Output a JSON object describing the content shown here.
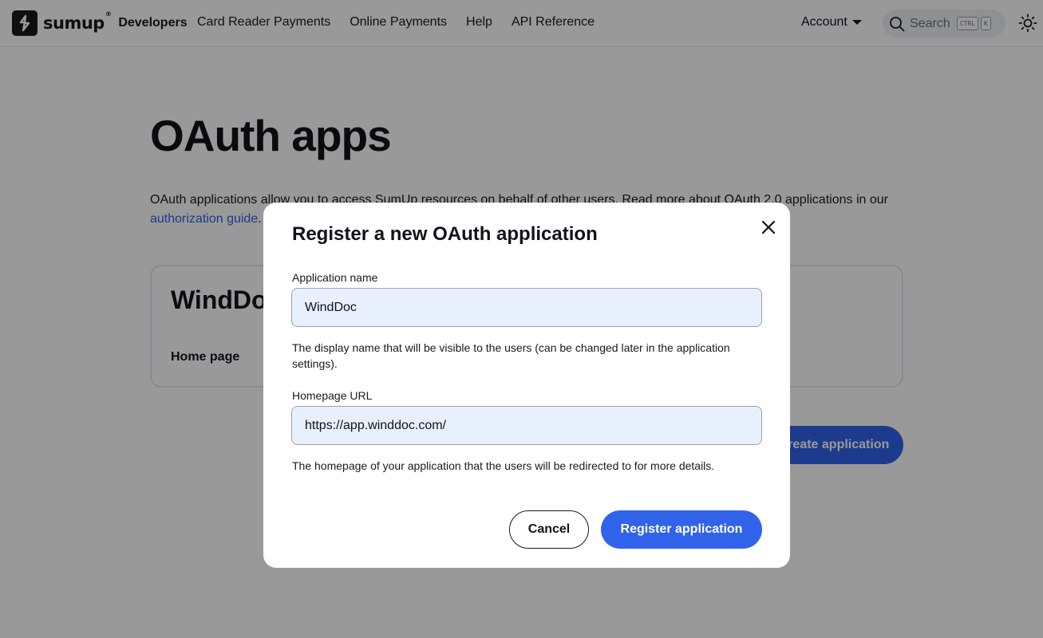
{
  "header": {
    "brand_word": "sumup",
    "brand_reg": "®",
    "brand_suffix": "Developers",
    "nav": [
      "Card Reader Payments",
      "Online Payments",
      "Help",
      "API Reference"
    ],
    "account_label": "Account",
    "search_placeholder": "Search",
    "search_keys": [
      "CTRL",
      "K"
    ]
  },
  "page": {
    "title": "OAuth apps",
    "intro_text": "OAuth applications allow you to access SumUp resources on behalf of other users. Read more about OAuth 2.0 applications in our ",
    "intro_link": "authorization guide",
    "intro_end": ".",
    "app_card": {
      "name": "WindDoc",
      "home_label": "Home page"
    },
    "create_button": "Create application"
  },
  "modal": {
    "title": "Register a new OAuth application",
    "name_label": "Application name",
    "name_value": "WindDoc",
    "name_help": "The display name that will be visible to the users (can be changed later in the application settings).",
    "url_label": "Homepage URL",
    "url_value": "https://app.winddoc.com/",
    "url_help": "The homepage of your application that the users will be redirected to for more details.",
    "cancel_label": "Cancel",
    "register_label": "Register application"
  },
  "colors": {
    "accent": "#3063e9",
    "overlay": "rgba(0,0,0,0.4)",
    "input_bg": "#e8f0fe"
  },
  "icons": [
    "sumup-logo-icon",
    "chevron-down-icon",
    "search-icon",
    "sun-icon",
    "close-icon"
  ]
}
